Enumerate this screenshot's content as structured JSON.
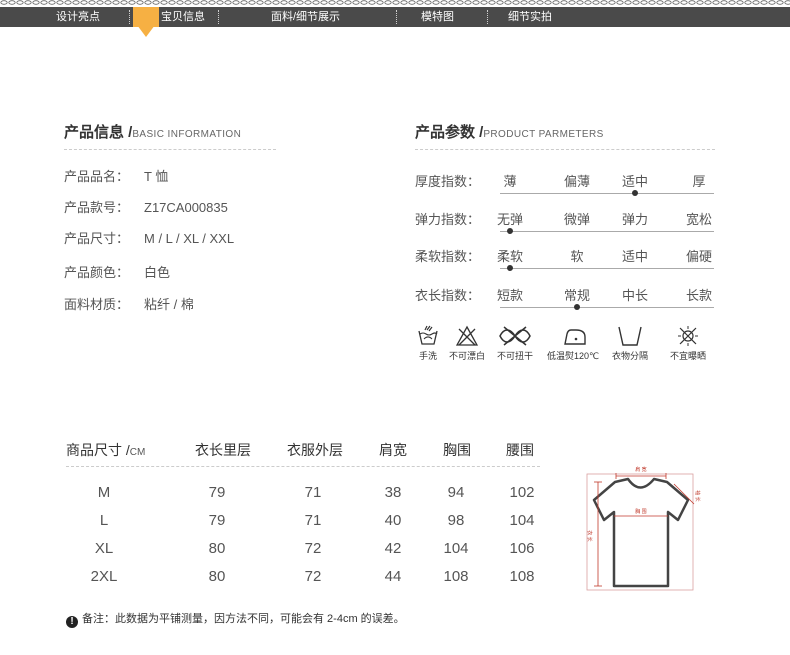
{
  "nav": {
    "items": [
      "设计亮点",
      "宝贝信息",
      "面料/细节展示",
      "模特图",
      "细节实拍"
    ],
    "active_index": 1
  },
  "product_info": {
    "title": "产品信息 /",
    "subtitle": "BASIC INFORMATION",
    "rows": [
      {
        "label": "产品品名：",
        "value": "T 恤"
      },
      {
        "label": "产品款号：",
        "value": "Z17CA000835"
      },
      {
        "label": "产品尺寸：",
        "value": "M / L / XL / XXL"
      },
      {
        "label": "产品颜色：",
        "value": "白色"
      },
      {
        "label": "面料材质：",
        "value": "粘纤 / 棉"
      }
    ]
  },
  "product_params": {
    "title": "产品参数 /",
    "subtitle": "PRODUCT PARMETERS",
    "rows": [
      {
        "label": "厚度指数：",
        "options": [
          "薄",
          "偏薄",
          "适中",
          "厚"
        ],
        "selected": 2
      },
      {
        "label": "弹力指数：",
        "options": [
          "无弹",
          "微弹",
          "弹力",
          "宽松"
        ],
        "selected": 0
      },
      {
        "label": "柔软指数：",
        "options": [
          "柔软",
          "软",
          "适中",
          "偏硬"
        ],
        "selected": 0
      },
      {
        "label": "衣长指数：",
        "options": [
          "短款",
          "常规",
          "中长",
          "长款"
        ],
        "selected": 1
      }
    ]
  },
  "care": [
    {
      "icon": "hand-wash-icon",
      "label": "手洗"
    },
    {
      "icon": "no-bleach-icon",
      "label": "不可漂白"
    },
    {
      "icon": "no-wring-icon",
      "label": "不可扭干"
    },
    {
      "icon": "low-iron-icon",
      "label": "低温熨120℃"
    },
    {
      "icon": "dry-in-shade-icon",
      "label": "衣物分隔"
    },
    {
      "icon": "no-sun-dry-icon",
      "label": "不宜曝晒"
    }
  ],
  "size_table": {
    "header_first": "商品尺寸 /",
    "header_unit": "CM",
    "headers": [
      "衣长里层",
      "衣服外层",
      "肩宽",
      "胸围",
      "腰围"
    ],
    "rows": [
      [
        "M",
        "79",
        "71",
        "38",
        "94",
        "102"
      ],
      [
        "L",
        "79",
        "71",
        "40",
        "98",
        "104"
      ],
      [
        "XL",
        "80",
        "72",
        "42",
        "104",
        "106"
      ],
      [
        "2XL",
        "80",
        "72",
        "44",
        "108",
        "108"
      ]
    ]
  },
  "diagram": {
    "labels": [
      "肩 宽",
      "胸 围",
      "衣 长",
      "袖 长"
    ]
  },
  "note": {
    "icon": "exclamation-icon",
    "text": "备注：此数据为平铺测量，因方法不同，可能会有 2-4cm 的误差。"
  },
  "colors": {
    "nav_bg": "#4a4a4a",
    "accent": "#f6b043",
    "measure": "#c0392b"
  }
}
